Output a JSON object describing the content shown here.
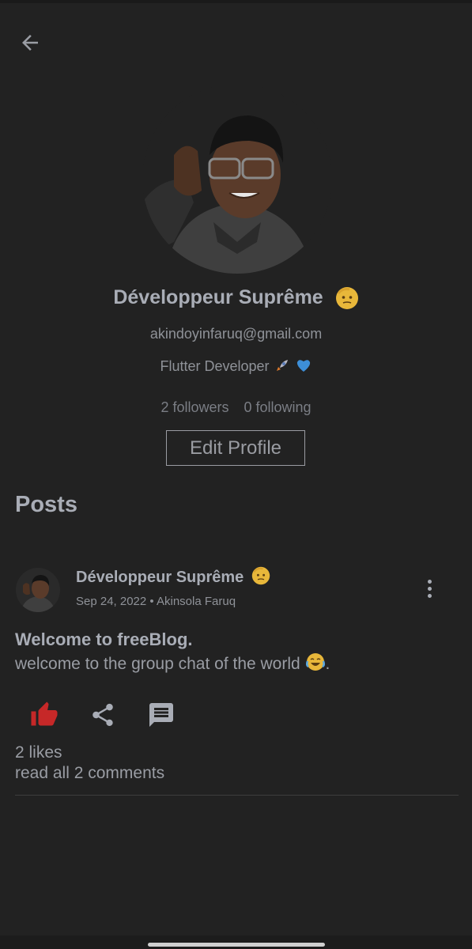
{
  "profile": {
    "name": "Développeur Suprême",
    "email": "akindoyinfaruq@gmail.com",
    "bio": "Flutter Developer",
    "followers": "2 followers",
    "following": "0 following",
    "edit_label": "Edit Profile"
  },
  "posts_section": {
    "title": "Posts"
  },
  "post": {
    "author": "Développeur Suprême",
    "meta": "Sep 24, 2022 • Akinsola Faruq",
    "title": "Welcome to freeBlog.",
    "body": "welcome to the group chat of the world",
    "likes": "2 likes",
    "comments": "read all 2 comments"
  },
  "icons": {
    "back": "arrow-back-icon",
    "more": "more-vert-icon",
    "like": "thumb-up-icon",
    "share": "share-icon",
    "comment": "comment-icon"
  },
  "colors": {
    "background": "#222222",
    "text": "#a9adb6",
    "liked": "#c62828"
  }
}
